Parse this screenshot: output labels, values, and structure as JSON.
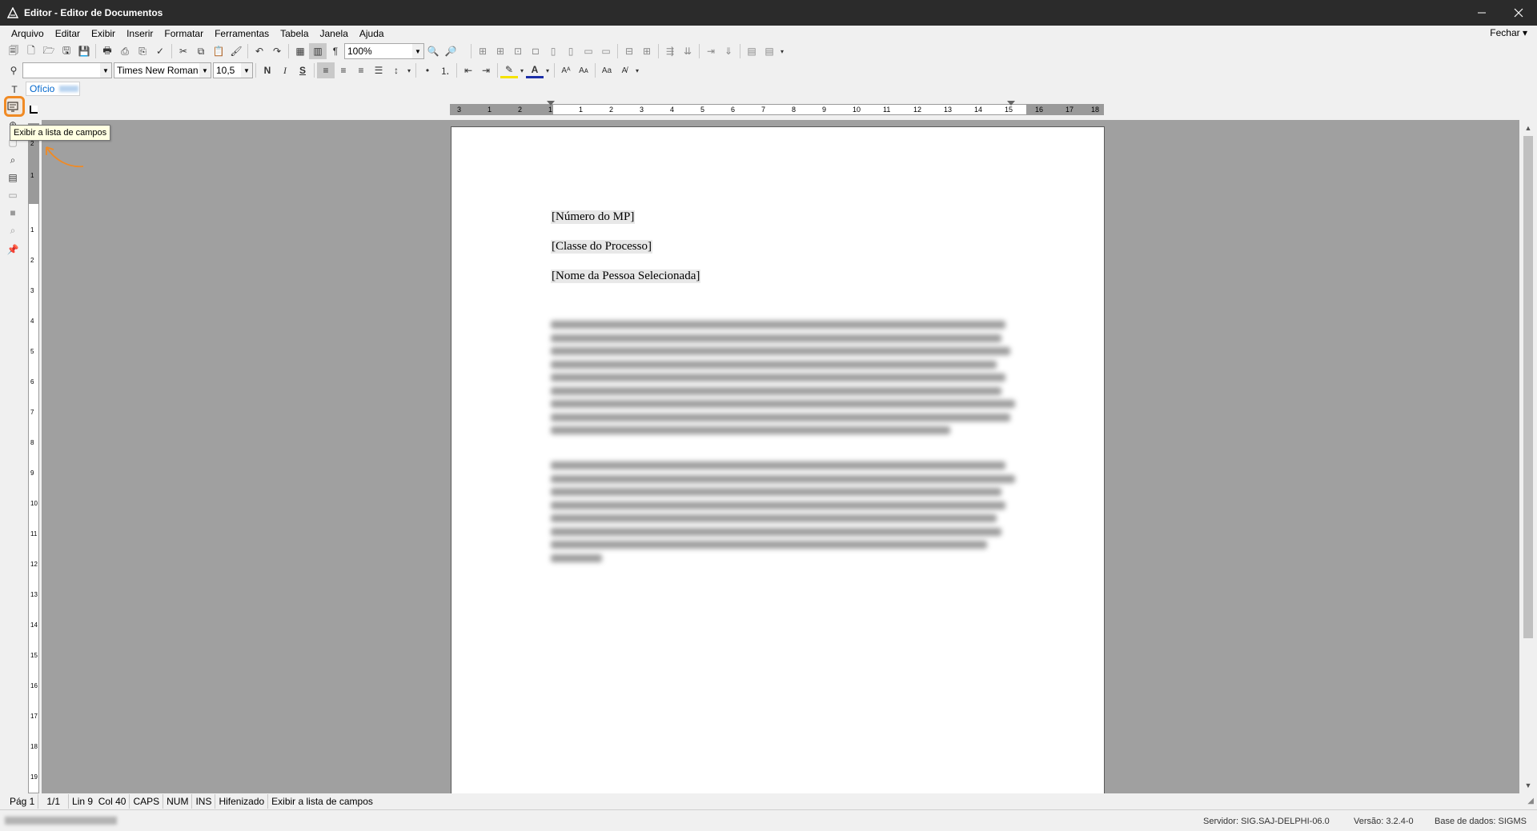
{
  "window": {
    "title": "Editor - Editor de Documentos"
  },
  "menu": {
    "items": [
      "Arquivo",
      "Editar",
      "Exibir",
      "Inserir",
      "Formatar",
      "Ferramentas",
      "Tabela",
      "Janela",
      "Ajuda"
    ],
    "fechar": "Fechar"
  },
  "toolbar": {
    "zoom": "100%",
    "font": "Times New Roman",
    "size": "10,5",
    "bold": "N",
    "italic": "I",
    "underline": "S"
  },
  "tab": {
    "label": "Ofício"
  },
  "tooltip": {
    "text": "Exibir a lista de campos"
  },
  "ruler": {
    "h_labels": [
      "3",
      "1",
      "2",
      "1",
      "1",
      "2",
      "3",
      "4",
      "5",
      "6",
      "7",
      "8",
      "9",
      "10",
      "11",
      "12",
      "13",
      "14",
      "15",
      "16",
      "17",
      "18"
    ],
    "v_labels": [
      "2",
      "1",
      "1",
      "2",
      "3",
      "4",
      "5",
      "6",
      "7",
      "8",
      "9",
      "10",
      "11",
      "12",
      "13",
      "14",
      "15",
      "16",
      "17",
      "18",
      "19"
    ]
  },
  "document": {
    "fields": [
      "[Número do MP]",
      "[Classe do Processo]",
      "[Nome da Pessoa Selecionada]"
    ],
    "blurred_paragraphs": [
      9,
      8
    ]
  },
  "statusbar": {
    "page": "Pág 1",
    "page_of": "1/1",
    "position": "Lin 9  Col 40",
    "caps": "CAPS",
    "num": "NUM",
    "ins": "INS",
    "hyphen": "Hifenizado",
    "hint": "Exibir a lista de campos"
  },
  "bottom": {
    "server": "Servidor: SIG.SAJ-DELPHI-06.0",
    "version": "Versão: 3.2.4-0",
    "database": "Base de dados: SIGMS"
  }
}
